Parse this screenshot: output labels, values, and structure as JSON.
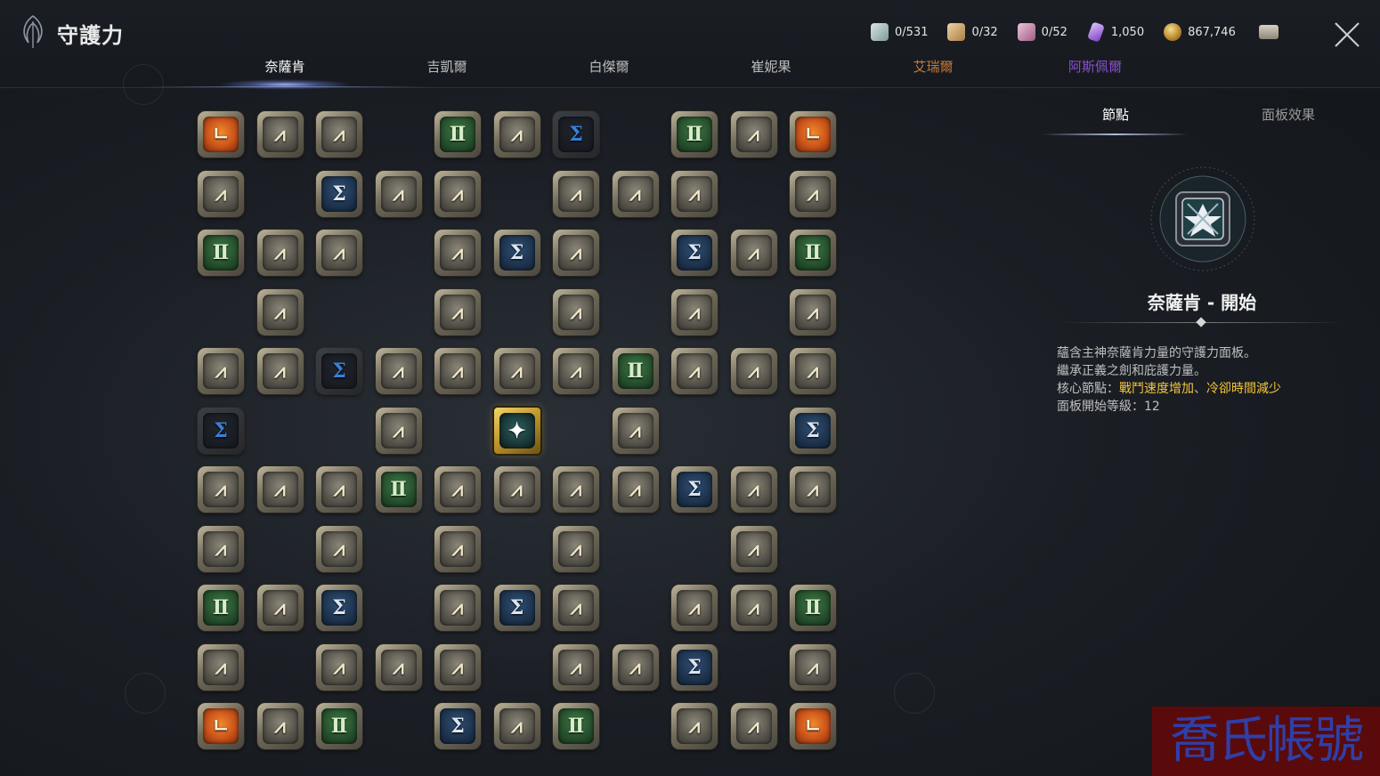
{
  "header": {
    "title": "守護力",
    "currencies": [
      {
        "value": "0/531",
        "icon": "scroll-icon",
        "color": "#b9c7c7"
      },
      {
        "value": "0/32",
        "icon": "parchment-icon",
        "color": "#d9b88a"
      },
      {
        "value": "0/52",
        "icon": "portrait-scroll-icon",
        "color": "#d79bbd"
      },
      {
        "value": "1,050",
        "icon": "purple-crystal-icon",
        "color": "#b884e8"
      },
      {
        "value": "867,746",
        "icon": "gold-coin-icon",
        "color": "#caa24a"
      }
    ],
    "close_icon": "close-icon"
  },
  "tabs": [
    {
      "label": "奈薩肯",
      "color": "#ffffff",
      "active": true
    },
    {
      "label": "吉凱爾",
      "color": "#bdbdbd"
    },
    {
      "label": "白傑爾",
      "color": "#bdbdbd"
    },
    {
      "label": "崔妮果",
      "color": "#bdbdbd"
    },
    {
      "label": "艾瑞爾",
      "color": "#c8793a"
    },
    {
      "label": "阿斯佩爾",
      "color": "#8a4fd0"
    }
  ],
  "node_types": {
    "normal": {
      "glyph": "⩘",
      "icon": "stat-rune-icon"
    },
    "green": {
      "glyph": "Ⅱ",
      "icon": "green-rune-icon"
    },
    "blue": {
      "glyph": "Σ",
      "icon": "sigma-rune-icon"
    },
    "dark": {
      "glyph": "Σ",
      "icon": "locked-sigma-rune-icon"
    },
    "orange": {
      "glyph": "ㄴ",
      "icon": "fire-rune-icon"
    },
    "core": {
      "glyph": "✦",
      "icon": "core-emblem-icon"
    }
  },
  "board": [
    [
      "orange",
      "normal",
      "normal",
      "",
      "green",
      "normal",
      "dark",
      "",
      "green",
      "normal",
      "orange"
    ],
    [
      "normal",
      "",
      "blue",
      "normal",
      "normal",
      "",
      "normal",
      "normal",
      "normal",
      "",
      "normal"
    ],
    [
      "green",
      "normal",
      "normal",
      "",
      "normal",
      "blue",
      "normal",
      "",
      "blue",
      "normal",
      "green"
    ],
    [
      "",
      "normal",
      "",
      "",
      "normal",
      "",
      "normal",
      "",
      "normal",
      "",
      "normal"
    ],
    [
      "normal",
      "normal",
      "dark",
      "normal",
      "normal",
      "normal",
      "normal",
      "green",
      "normal",
      "normal",
      "normal"
    ],
    [
      "dark",
      "",
      "",
      "normal",
      "",
      "core",
      "",
      "normal",
      "",
      "",
      "blue"
    ],
    [
      "normal",
      "normal",
      "normal",
      "green",
      "normal",
      "normal",
      "normal",
      "normal",
      "blue",
      "normal",
      "normal"
    ],
    [
      "normal",
      "",
      "normal",
      "",
      "normal",
      "",
      "normal",
      "",
      "",
      "normal",
      ""
    ],
    [
      "green",
      "normal",
      "blue",
      "",
      "normal",
      "blue",
      "normal",
      "",
      "normal",
      "normal",
      "green"
    ],
    [
      "normal",
      "",
      "normal",
      "normal",
      "normal",
      "",
      "normal",
      "normal",
      "blue",
      "",
      "normal"
    ],
    [
      "orange",
      "normal",
      "green",
      "",
      "blue",
      "normal",
      "green",
      "",
      "normal",
      "normal",
      "orange"
    ]
  ],
  "side_panel": {
    "tabs": [
      {
        "label": "節點",
        "active": true
      },
      {
        "label": "面板效果"
      }
    ],
    "emblem_icon": "nasaken-emblem-icon",
    "title": "奈薩肯 - 開始",
    "line1": "蘊含主神奈薩肯力量的守護力面板。",
    "line2": "繼承正義之劍和庇護力量。",
    "line3_prefix": "核心節點：",
    "line3_hl1": "戰鬥速度增加",
    "line3_sep": "、",
    "line3_hl2": "冷卻時間減少",
    "line4": "面板開始等級：12"
  },
  "watermark": "喬氏帳號"
}
